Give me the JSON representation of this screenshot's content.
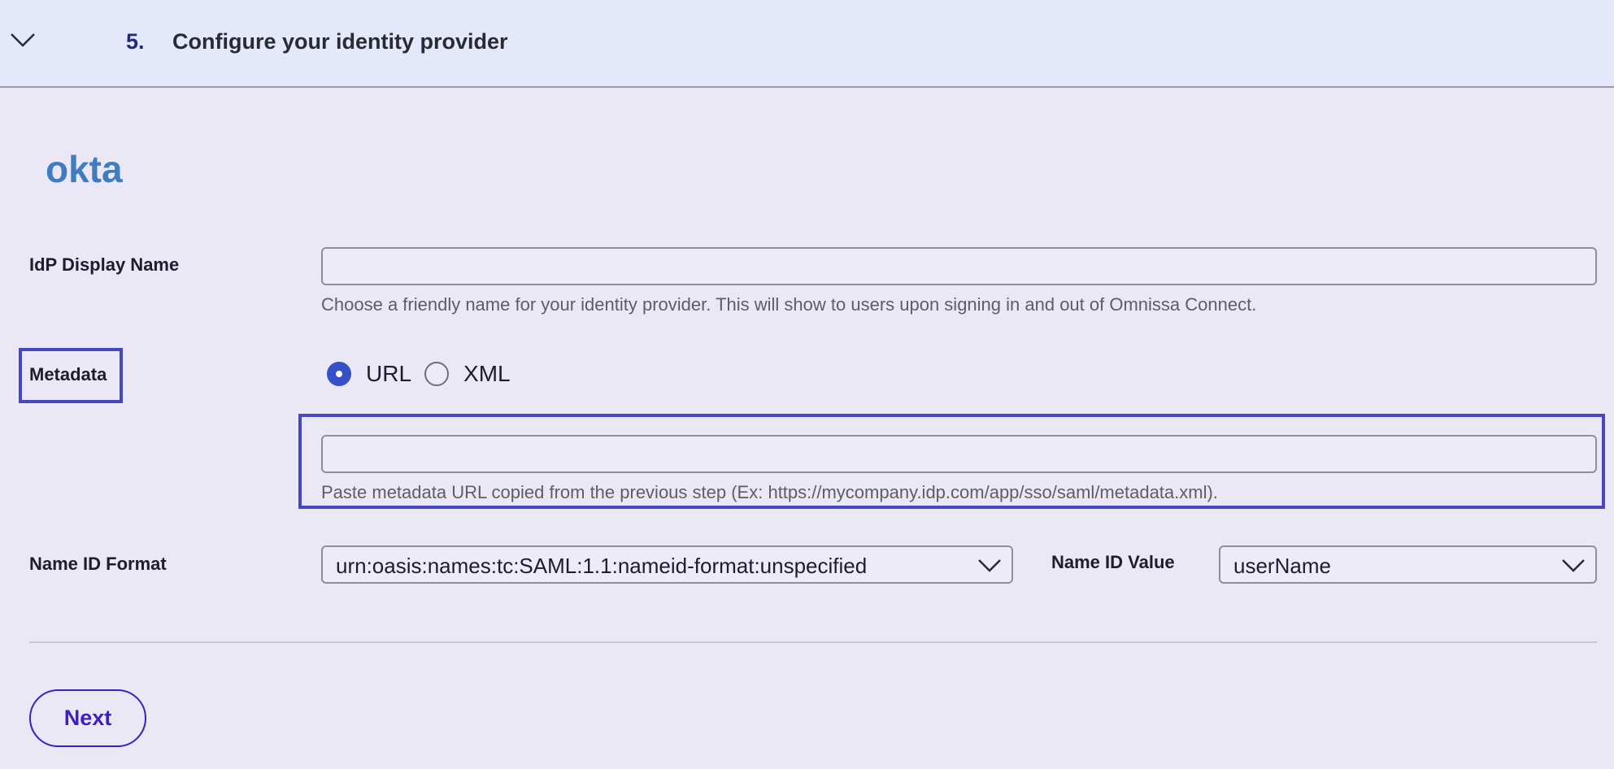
{
  "step": {
    "number": "5.",
    "title": "Configure your identity provider"
  },
  "logo": {
    "text": "okta",
    "color": "#3f7dbf"
  },
  "idp_display_name": {
    "label": "IdP Display Name",
    "value": "",
    "placeholder": "",
    "helper": "Choose a friendly name for your identity provider. This will show to users upon signing in and out of Omnissa Connect."
  },
  "metadata": {
    "label": "Metadata",
    "options": [
      {
        "label": "URL",
        "checked": true
      },
      {
        "label": "XML",
        "checked": false
      }
    ],
    "url_value": "",
    "url_placeholder": "",
    "helper": "Paste metadata URL copied from the previous step (Ex: https://mycompany.idp.com/app/sso/saml/metadata.xml)."
  },
  "name_id_format": {
    "label": "Name ID Format",
    "selected": "urn:oasis:names:tc:SAML:1.1:nameid-format:unspecified"
  },
  "name_id_value": {
    "label": "Name ID Value",
    "selected": "userName"
  },
  "actions": {
    "next_label": "Next"
  },
  "colors": {
    "accent": "#3d1fc2",
    "highlight": "#4747c2",
    "radio_checked": "#3451c8"
  },
  "icons": {
    "header_toggle": "chevron-down-icon",
    "dropdown": "chevron-down-icon"
  }
}
